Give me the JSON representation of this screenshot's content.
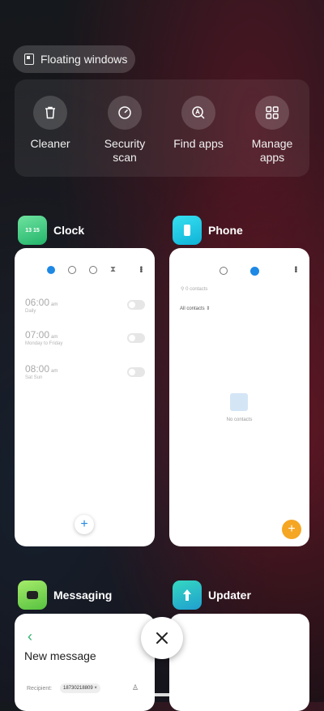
{
  "floating_windows": {
    "label": "Floating windows",
    "icon": "window-icon"
  },
  "quick_actions": [
    {
      "label": "Cleaner",
      "icon": "trash-icon"
    },
    {
      "label": "Security\nscan",
      "icon": "speedometer-icon"
    },
    {
      "label": "Find apps",
      "icon": "search-apps-icon"
    },
    {
      "label": "Manage\napps",
      "icon": "grid-icon"
    }
  ],
  "apps": {
    "clock": {
      "name": "Clock",
      "icon_text": "13 15",
      "alarms": [
        {
          "time": "06:00",
          "ampm": "am",
          "repeat": "Daily"
        },
        {
          "time": "07:00",
          "ampm": "am",
          "repeat": "Monday to Friday"
        },
        {
          "time": "08:00",
          "ampm": "am",
          "repeat": "Sat Sun"
        }
      ],
      "fab": "+"
    },
    "phone": {
      "name": "Phone",
      "search_placeholder": "0 contacts",
      "filter": "All contacts",
      "empty_text": "No contacts",
      "fab": "+"
    },
    "messaging": {
      "name": "Messaging",
      "back": "‹",
      "title": "New message",
      "recipient_label": "Recipient:",
      "recipient_chip": "18730218809 ×"
    },
    "updater": {
      "name": "Updater"
    }
  },
  "colors": {
    "clock_accent": "#1e88e5",
    "phone_fab": "#f5a623",
    "clock_icon": "#34c87a",
    "phone_icon": "#19c6e0",
    "messaging_icon": "#7ed957",
    "updater_icon": "#2bc5c0"
  }
}
